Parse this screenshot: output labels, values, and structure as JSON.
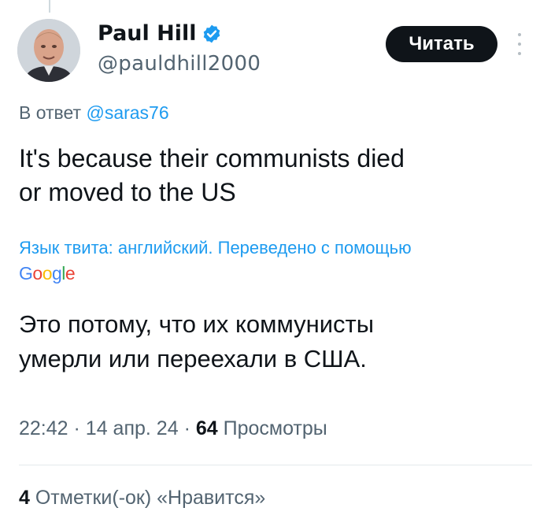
{
  "author": {
    "name": "Paul Hill",
    "handle": "@pauldhill2000",
    "verified": true
  },
  "follow_label": "Читать",
  "reply": {
    "prefix": "В ответ",
    "to": "@saras76"
  },
  "tweet": {
    "line1": "It's because their communists died",
    "line2": "or moved to the US"
  },
  "translation": {
    "note": "Язык твита: английский. Переведено с помощью",
    "provider": "Google",
    "line1": "Это потому, что их коммунисты",
    "line2": "умерли или переехали в США."
  },
  "meta": {
    "time": "22:42",
    "date": "14 апр. 24",
    "views_count": "64",
    "views_label": "Просмотры"
  },
  "likes": {
    "count": "4",
    "label": "Отметки(-ок) «Нравится»"
  },
  "colors": {
    "accent": "#1d9bf0",
    "text": "#0f1419",
    "secondary": "#536471",
    "button": "#0f1419"
  },
  "icons": [
    "verified-badge-icon",
    "more-options-icon",
    "google-logo"
  ]
}
